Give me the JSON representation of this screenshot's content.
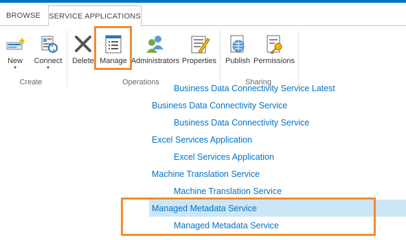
{
  "tabs": {
    "browse": "BROWSE",
    "service_applications": "SERVICE APPLICATIONS"
  },
  "ribbon": {
    "groups": {
      "create": "Create",
      "operations": "Operations",
      "sharing": "Sharing"
    },
    "buttons": {
      "new": "New",
      "connect": "Connect",
      "delete": "Delete",
      "manage": "Manage",
      "administrators": "Administrators",
      "properties": "Properties",
      "publish": "Publish",
      "permissions": "Permissions"
    },
    "icons": {
      "new": "new-service-icon",
      "connect": "connect-icon",
      "delete": "delete-x-icon",
      "manage": "manage-list-icon",
      "administrators": "administrators-people-icon",
      "properties": "properties-pencil-icon",
      "publish": "publish-globe-icon",
      "permissions": "permissions-key-icon"
    }
  },
  "service_list": [
    {
      "label": "Business Data Connectivity Service Latest",
      "level": "child",
      "selected": false
    },
    {
      "label": "Business Data Connectivity Service",
      "level": "parent",
      "selected": false
    },
    {
      "label": "Business Data Connectivity Service",
      "level": "child",
      "selected": false
    },
    {
      "label": "Excel Services Application",
      "level": "parent",
      "selected": false
    },
    {
      "label": "Excel Services Application",
      "level": "child",
      "selected": false
    },
    {
      "label": "Machine Translation Service",
      "level": "parent",
      "selected": false
    },
    {
      "label": "Machine Translation Service",
      "level": "child",
      "selected": false
    },
    {
      "label": "Managed Metadata Service",
      "level": "parent",
      "selected": true
    },
    {
      "label": "Managed Metadata Service",
      "level": "child",
      "selected": false
    }
  ],
  "colors": {
    "accent": "#0072c6",
    "highlight_box": "#f28a31",
    "selected_row": "#cde6f7"
  }
}
